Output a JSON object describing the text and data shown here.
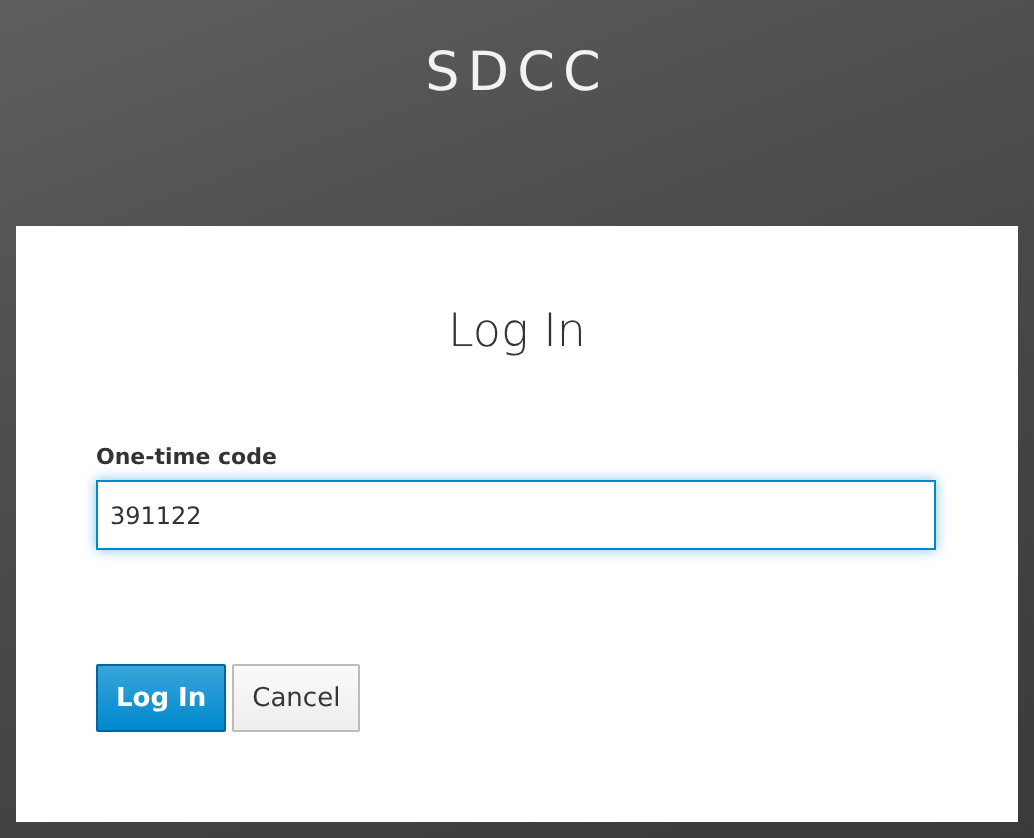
{
  "brand": {
    "title": "SDCC"
  },
  "login": {
    "heading": "Log In",
    "field": {
      "label": "One-time code",
      "value": "391122"
    },
    "buttons": [
      {
        "label": "Log In",
        "kind": "primary"
      },
      {
        "label": "Cancel",
        "kind": "default"
      }
    ]
  }
}
